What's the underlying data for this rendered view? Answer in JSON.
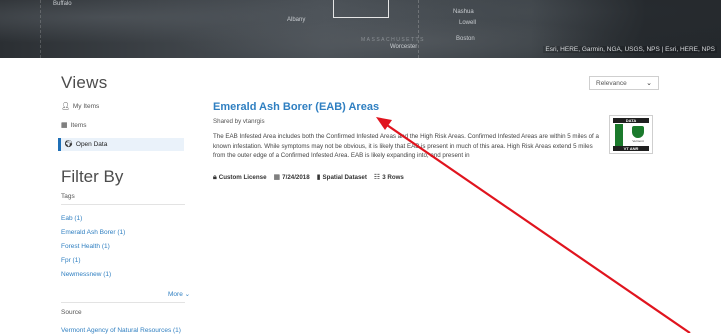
{
  "map": {
    "labels": {
      "top_left": "Buffalo",
      "albany": "Albany",
      "nashua": "Nashua",
      "lowell": "Lowell",
      "worcester": "Worcester",
      "boston": "Boston",
      "mass": "MASSACHUSETTS"
    },
    "attribution": "Esri, HERE, Garmin, NGA, USGS, NPS | Esri, HERE, NPS"
  },
  "sidebar": {
    "views_title": "Views",
    "items": [
      {
        "label": "My Items",
        "icon": "person-icon"
      },
      {
        "label": "Items",
        "icon": "building-icon"
      },
      {
        "label": "Open Data",
        "icon": "globe-icon",
        "active": true
      }
    ],
    "filter_title": "Filter By",
    "tags_heading": "Tags",
    "tags": [
      "Eab (1)",
      "Emerald Ash Borer (1)",
      "Forest Health (1)",
      "Fpr (1)",
      "Newmessnew (1)"
    ],
    "more_label": "More",
    "source_heading": "Source",
    "source_cut_text": "Vermont Agency of Natural Resources (1)"
  },
  "sort": {
    "selected": "Relevance"
  },
  "result": {
    "title": "Emerald Ash Borer (EAB) Areas",
    "shared_by": "Shared by vtanrgis",
    "description": "The EAB Infested Area includes both the Confirmed Infested Areas and the High Risk Areas. Confirmed Infested Areas are within 5 miles of a known infestation. While symptoms may not be obvious, it is likely that EAB is present in much of this area. High Risk Areas extend 5 miles from the outer edge of a Confirmed Infested Area. EAB is likely expanding into, and present in",
    "license": "Custom License",
    "date": "7/24/2018",
    "type": "Spatial Dataset",
    "rows": "3 Rows",
    "thumb_top": "DATA",
    "thumb_bottom": "VT ANR",
    "thumb_logo_text": "Vermont"
  },
  "colors": {
    "link": "#2f7fc1",
    "active_border": "#1f6fb6",
    "arrow": "#e0141e"
  }
}
